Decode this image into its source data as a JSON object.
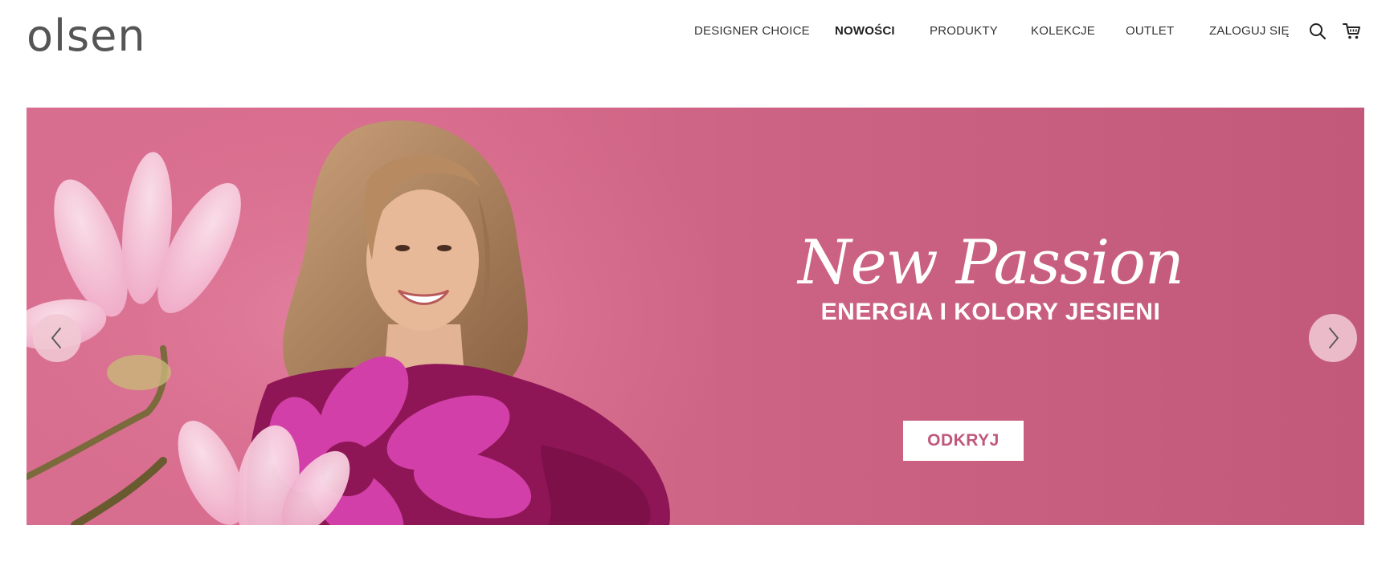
{
  "header": {
    "logo": "olsen",
    "nav": [
      {
        "label": "DESIGNER CHOICE",
        "bold": false
      },
      {
        "label": "NOWOŚCI",
        "bold": true
      },
      {
        "label": "PRODUKTY",
        "bold": false
      },
      {
        "label": "KOLEKCJE",
        "bold": false
      },
      {
        "label": "OUTLET",
        "bold": false
      },
      {
        "label": "ZALOGUJ SIĘ",
        "bold": false
      }
    ],
    "icons": {
      "search": "search-icon",
      "cart": "cart-icon"
    }
  },
  "hero": {
    "title": "New Passion",
    "subtitle": "ENERGIA I KOLORY JESIENI",
    "cta_label": "ODKRYJ",
    "icons": {
      "prev": "chevron-left-icon",
      "next": "chevron-right-icon"
    },
    "colors": {
      "background": "#cc6384",
      "cta_text": "#c0587a",
      "sweater": "#8e1656",
      "flower": "#d23fa8"
    }
  }
}
